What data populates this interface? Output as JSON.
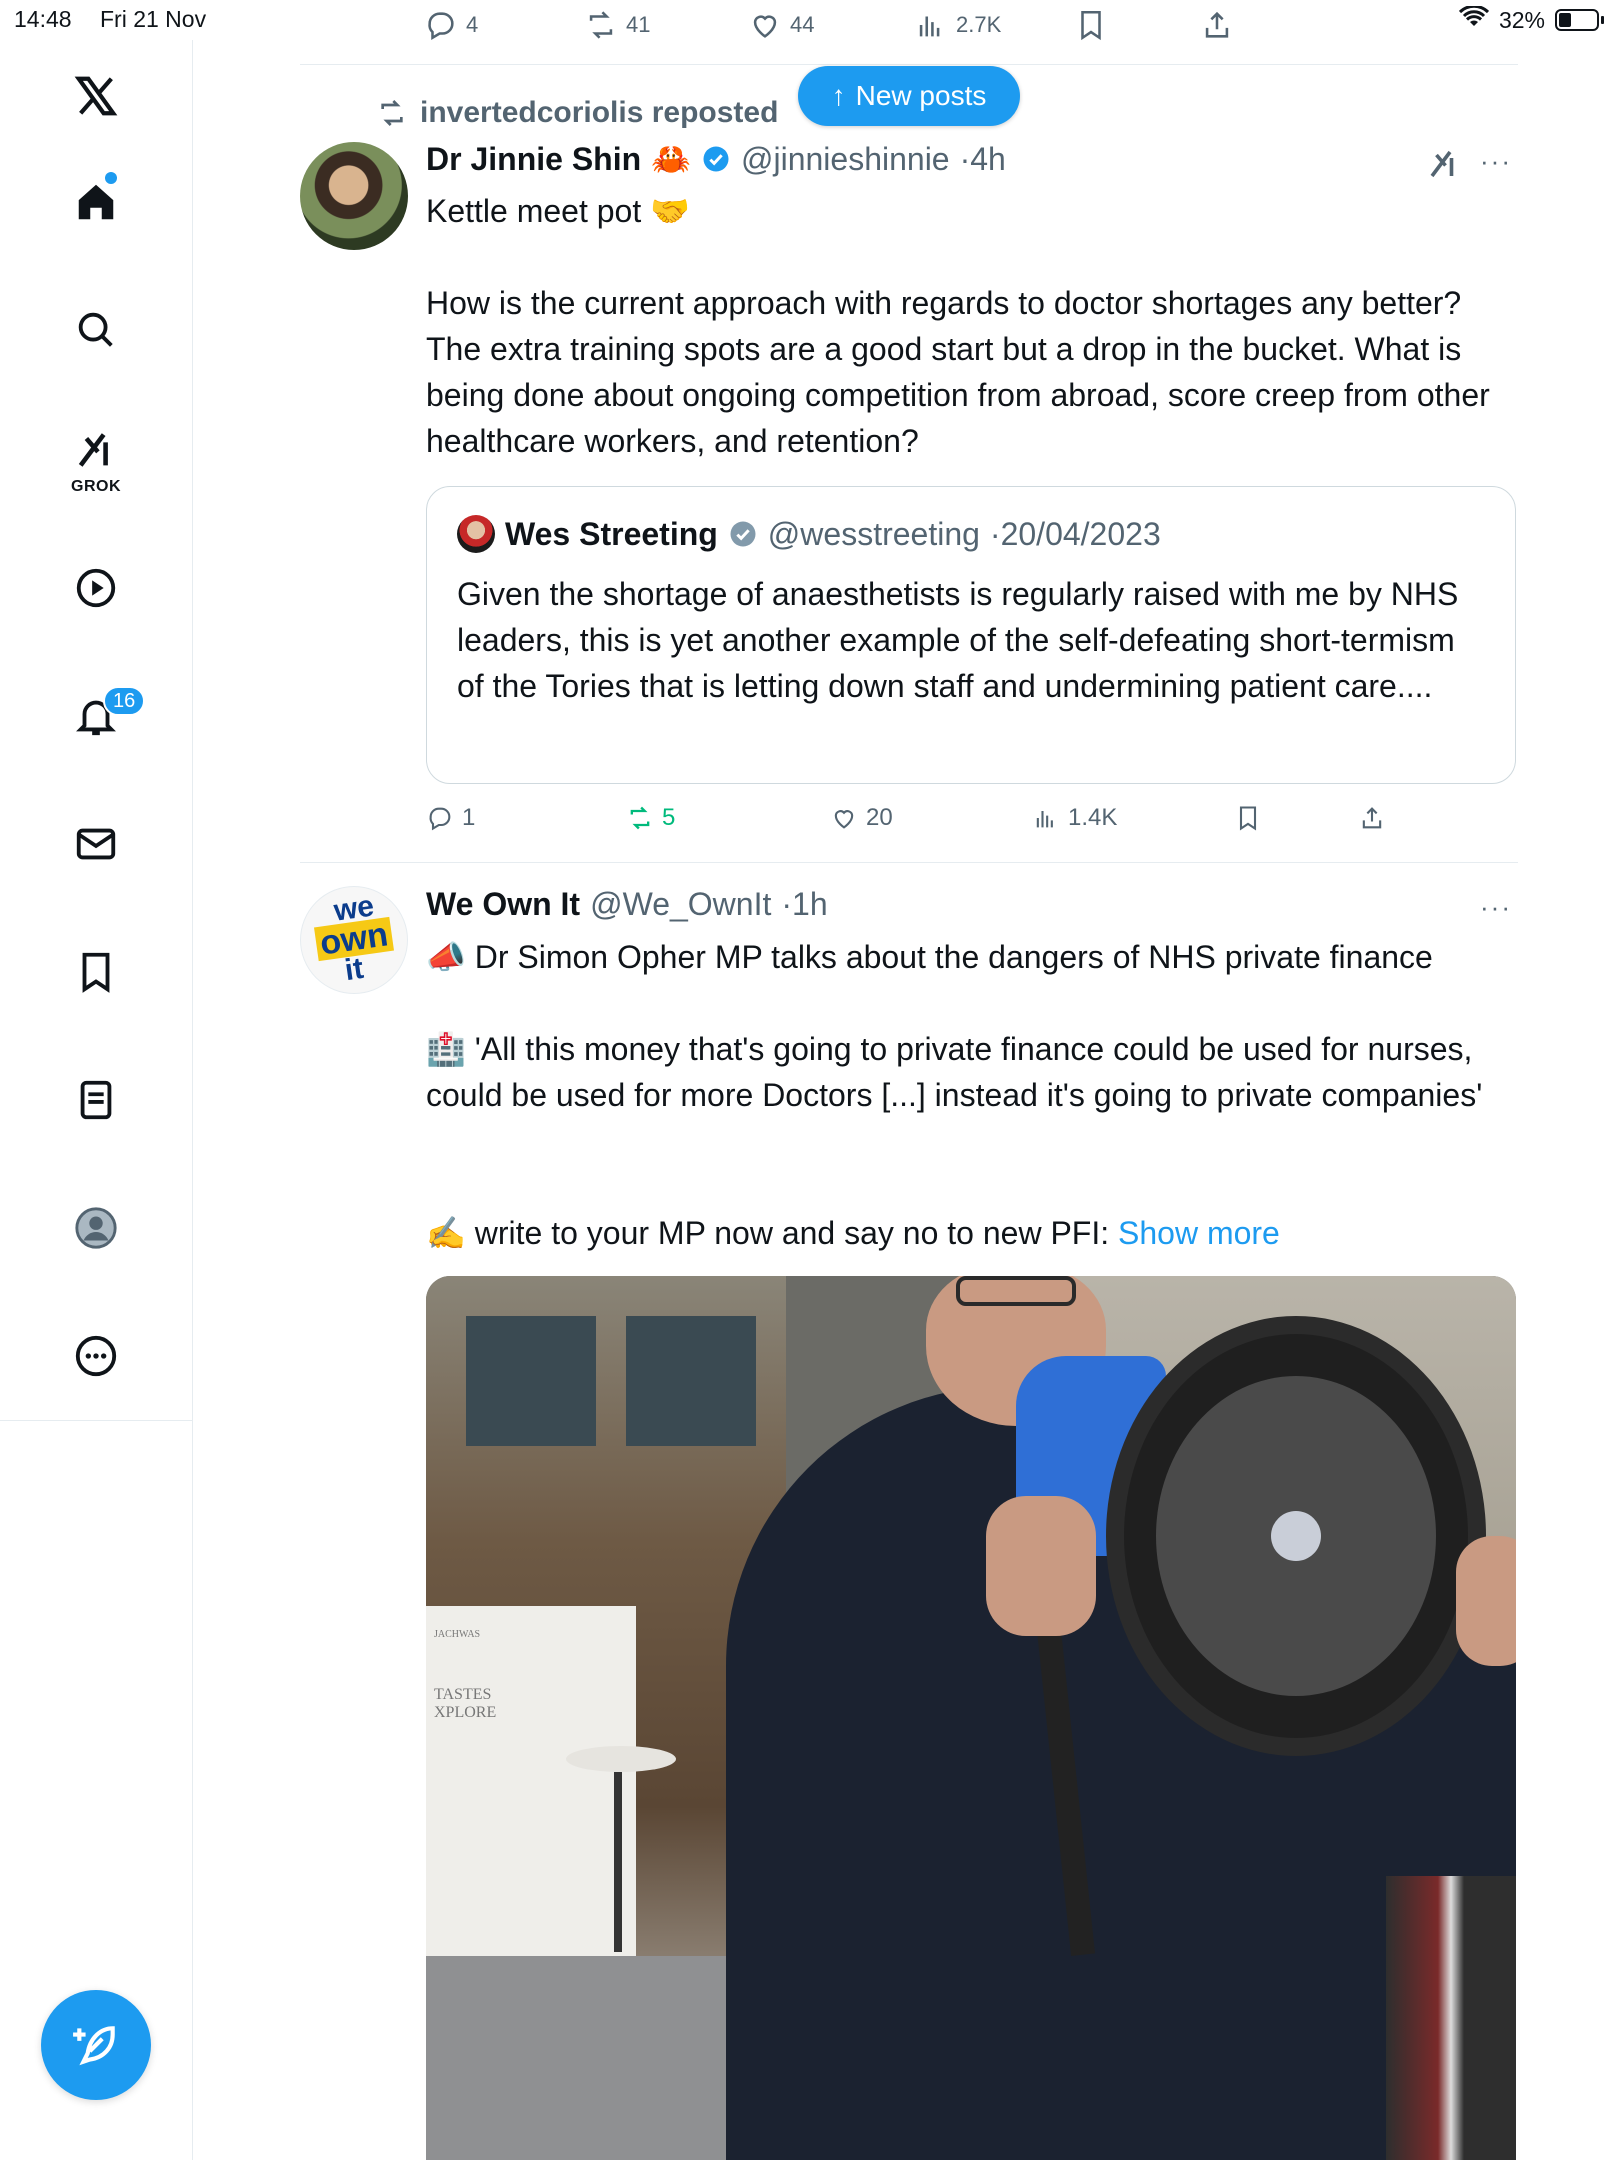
{
  "status_bar": {
    "time": "14:48",
    "date": "Fri 21 Nov",
    "battery": "32%"
  },
  "top_actions": {
    "replies": "4",
    "reposts": "41",
    "likes": "44",
    "views": "2.7K"
  },
  "sidebar": {
    "grok_label": "GROK",
    "notifications_count": "16"
  },
  "new_posts_label": "New posts",
  "tweet1": {
    "repost_line": "invertedcoriolis reposted",
    "name": "Dr Jinnie Shin",
    "name_emoji": "🦀",
    "handle": "@jinnieshinnie",
    "time": "·4h",
    "line1": "Kettle meet pot 🤝",
    "para": "How is the current approach with regards to doctor shortages any better? The extra training spots are a good start but a drop in the bucket. What is being done about ongoing competition from abroad, score creep from other healthcare workers, and retention?",
    "quote": {
      "name": "Wes Streeting",
      "handle": "@wesstreeting",
      "date": "·20/04/2023",
      "text": "Given the shortage of anaesthetists is regularly raised with me by NHS leaders, this is yet another example of the self-defeating short-termism of the Tories that is letting down staff and undermining patient care...."
    },
    "actions": {
      "replies": "1",
      "reposts": "5",
      "likes": "20",
      "views": "1.4K"
    }
  },
  "tweet2": {
    "avatar_text": {
      "we": "we",
      "own": "own",
      "it": "it"
    },
    "name": "We Own It",
    "handle": "@We_OwnIt",
    "time": "·1h",
    "line1": "📣 Dr Simon Opher MP talks about the dangers of NHS private finance",
    "line2": "🏥 'All this money that's going to private finance could be used for nurses, could be used for more Doctors [...] instead it's going to private companies'",
    "line3": "✍️ write to your MP now and say no to new PFI:",
    "show_more": "Show more",
    "media_sign_top": "JACHWAS",
    "media_sign_line1": "TASTES",
    "media_sign_line2": "XPLORE"
  },
  "colors": {
    "accent": "#1d9bf0",
    "text": "#0f1419",
    "muted": "#536471",
    "repost_green": "#00ba7c"
  }
}
